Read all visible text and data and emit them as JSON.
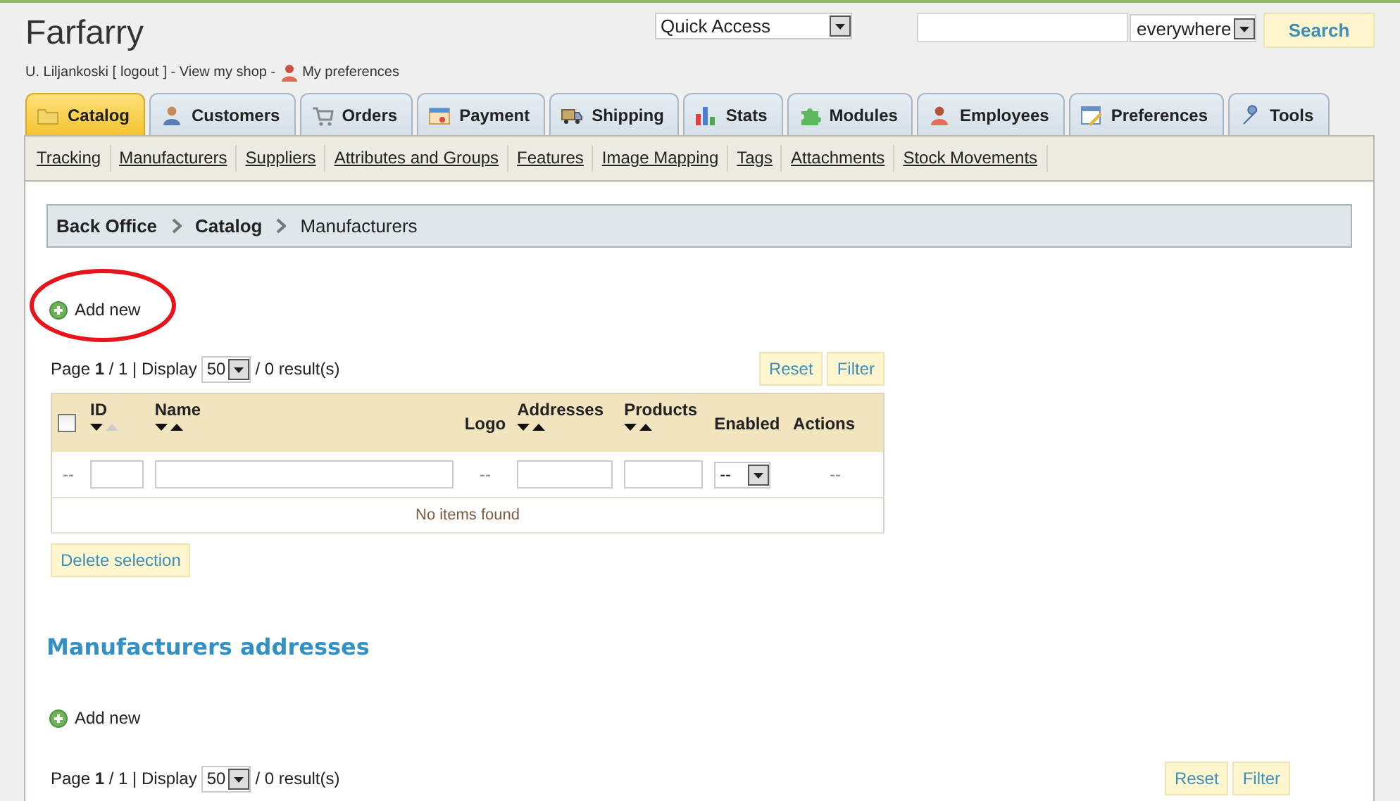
{
  "header": {
    "shop_title": "Farfarry",
    "user": "U. Liljankoski [",
    "logout": "logout",
    "user_end": "] - View my shop -",
    "preferences": "My preferences",
    "quick_access": "Quick Access",
    "search_scope": "everywhere",
    "search_button": "Search"
  },
  "tabs": [
    {
      "label": "Catalog",
      "selected": true
    },
    {
      "label": "Customers",
      "selected": false
    },
    {
      "label": "Orders",
      "selected": false
    },
    {
      "label": "Payment",
      "selected": false
    },
    {
      "label": "Shipping",
      "selected": false
    },
    {
      "label": "Stats",
      "selected": false
    },
    {
      "label": "Modules",
      "selected": false
    },
    {
      "label": "Employees",
      "selected": false
    },
    {
      "label": "Preferences",
      "selected": false
    },
    {
      "label": "Tools",
      "selected": false
    }
  ],
  "subnav": [
    "Tracking",
    "Manufacturers",
    "Suppliers",
    "Attributes and Groups",
    "Features",
    "Image Mapping",
    "Tags",
    "Attachments",
    "Stock Movements"
  ],
  "breadcrumb": [
    "Back Office",
    "Catalog",
    "Manufacturers"
  ],
  "manufacturers": {
    "add_new": "Add new",
    "highlight": {
      "kind": "ellipse"
    },
    "pagination": {
      "page_info": "Page **1** / 1 | Display",
      "per_page": "50",
      "results": "/ 0 result(s)"
    },
    "reset_button": "Reset",
    "filter_button": "Filter",
    "select_all": {
      "checked": false
    },
    "columns": [
      {
        "label": "ID",
        "kind": "descending"
      },
      {
        "label": "Name",
        "kind": "sortable"
      },
      {
        "label": "Logo",
        "kind": "plain"
      },
      {
        "label": "Addresses",
        "kind": "sortable"
      },
      {
        "label": "Products",
        "kind": "sortable"
      },
      {
        "label": "Enabled",
        "kind": "plain"
      },
      {
        "label": "Actions",
        "kind": "plain"
      }
    ],
    "filters": [
      {
        "kind": "text",
        "text": "--"
      },
      {
        "kind": "input"
      },
      {
        "kind": "input"
      },
      {
        "kind": "text",
        "text": "--"
      },
      {
        "kind": "input"
      },
      {
        "kind": "input"
      },
      {
        "kind": "select",
        "value": "--"
      },
      {
        "kind": "text",
        "text": "--"
      }
    ],
    "empty_message": "No items found",
    "delete_button": "Delete selection"
  },
  "addresses": {
    "title": "Manufacturers addresses",
    "add_new": "Add new",
    "pagination": {
      "page_info": "Page **1** / 1 | Display",
      "per_page": "50",
      "results": "/ 0 result(s)"
    },
    "reset_button": "Reset",
    "filter_button": "Filter"
  }
}
